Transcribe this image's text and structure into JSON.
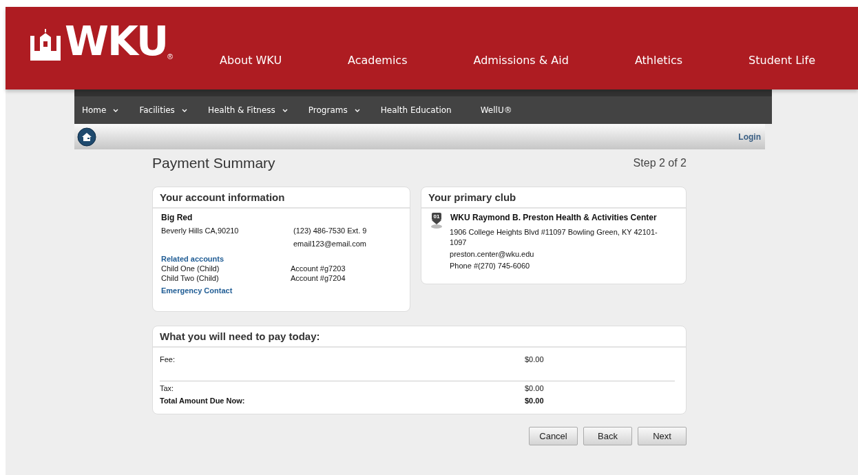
{
  "header": {
    "logo": "WKU",
    "registered": "®",
    "nav": [
      "About WKU",
      "Academics",
      "Admissions & Aid",
      "Athletics",
      "Student Life"
    ]
  },
  "subnav": [
    {
      "label": "Home",
      "dropdown": true
    },
    {
      "label": "Facilities",
      "dropdown": true
    },
    {
      "label": "Health & Fitness",
      "dropdown": true
    },
    {
      "label": "Programs",
      "dropdown": true
    },
    {
      "label": "Health Education",
      "dropdown": false
    },
    {
      "label": "WellU®",
      "dropdown": false
    }
  ],
  "toolbar": {
    "login": "Login"
  },
  "page": {
    "title": "Payment Summary",
    "step": "Step 2 of 2"
  },
  "account": {
    "title": "Your account information",
    "name": "Big Red",
    "address": "Beverly Hills CA,90210",
    "phone": "(123) 486-7530 Ext. 9",
    "email": "email123@email.com",
    "related_title": "Related accounts",
    "related": [
      {
        "name": "Child One (Child)",
        "account": "Account #g7203"
      },
      {
        "name": "Child Two (Child)",
        "account": "Account #g7204"
      }
    ],
    "emergency": "Emergency Contact"
  },
  "club": {
    "title": "Your primary club",
    "badge": "01",
    "name": "WKU Raymond B. Preston Health & Activities Center",
    "address": "1906 College Heights Blvd #11097 Bowling Green, KY 42101-1097",
    "email": "preston.center@wku.edu",
    "phone": "Phone #(270) 745-6060"
  },
  "payment": {
    "title": "What you will need to pay today:",
    "rows": [
      {
        "label": "Fee:",
        "amount": "$0.00",
        "kind": "fee"
      },
      {
        "label": "Tax:",
        "amount": "$0.00",
        "kind": "tax"
      },
      {
        "label": "Total Amount Due Now:",
        "amount": "$0.00",
        "kind": "total"
      }
    ]
  },
  "buttons": [
    "Cancel",
    "Back",
    "Next"
  ]
}
